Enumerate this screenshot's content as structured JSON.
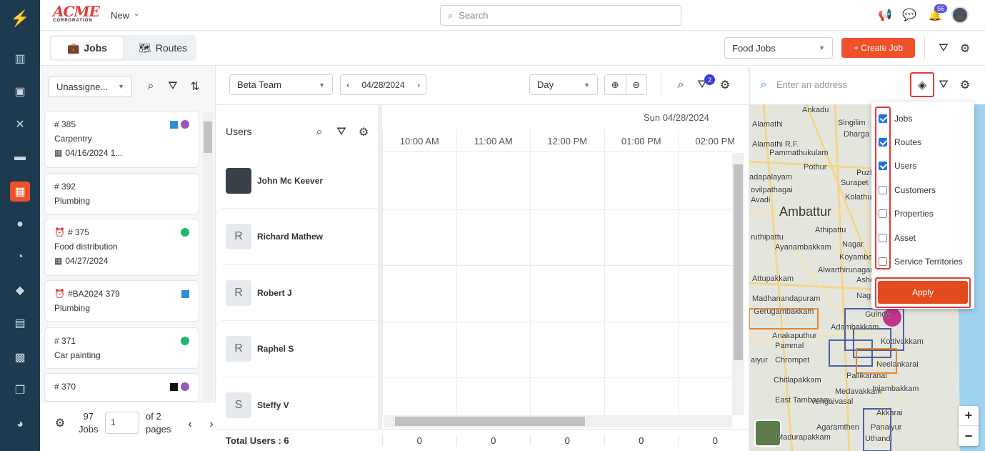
{
  "app": {
    "brand": "ACME",
    "brand_sub": "CORPORATION",
    "new_label": "New",
    "search_placeholder": "Search",
    "notif_count": "56"
  },
  "tabs": {
    "jobs": "Jobs",
    "routes": "Routes"
  },
  "header_right": {
    "job_filter": "Food Jobs",
    "create_job": "+ Create Job"
  },
  "jobs_panel": {
    "status_filter": "Unassigne...",
    "cards": [
      {
        "id": "# 385",
        "type": "Carpentry",
        "date": "04/16/2024 1...",
        "markers": [
          "#2b8fd6",
          "#9b59b6"
        ]
      },
      {
        "id": "# 392",
        "type": "Plumbing",
        "date": "",
        "markers": []
      },
      {
        "id": "# 375",
        "type": "Food distribution",
        "date": "04/27/2024",
        "markers": [
          "#22b573"
        ],
        "alarm": true
      },
      {
        "id": "#BA2024 379",
        "type": "Plumbing",
        "date": "",
        "markers": [
          "#2b8fd6"
        ],
        "alarm": true
      },
      {
        "id": "# 371",
        "type": "Car painting",
        "date": "",
        "markers": [
          "#22b573"
        ]
      },
      {
        "id": "# 370",
        "type": "",
        "date": "",
        "markers": [
          "#111111",
          "#9b59b6"
        ]
      }
    ],
    "footer": {
      "count": "97",
      "count_label": "Jobs",
      "page": "1",
      "of_pages": "of 2",
      "pages_label": "pages"
    }
  },
  "scheduler": {
    "team": "Beta Team",
    "date": "04/28/2024",
    "view": "Day",
    "filter_badge": "2",
    "date_header": "Sun 04/28/2024",
    "users_title": "Users",
    "times": [
      "10:00 AM",
      "11:00 AM",
      "12:00 PM",
      "01:00 PM",
      "02:00 PM"
    ],
    "users": [
      {
        "name": "John Mc Keever",
        "initial": "",
        "photo": true
      },
      {
        "name": "Richard Mathew",
        "initial": "R"
      },
      {
        "name": "Robert J",
        "initial": "R"
      },
      {
        "name": "Raphel S",
        "initial": "R"
      },
      {
        "name": "Steffy V",
        "initial": "S"
      }
    ],
    "total_label": "Total Users : 6",
    "totals": [
      "0",
      "0",
      "0",
      "0",
      "0"
    ]
  },
  "map": {
    "address_placeholder": "Enter an address",
    "layers": [
      {
        "label": "Jobs",
        "checked": true
      },
      {
        "label": "Routes",
        "checked": true
      },
      {
        "label": "Users",
        "checked": true
      },
      {
        "label": "Customers",
        "checked": false
      },
      {
        "label": "Properties",
        "checked": false
      },
      {
        "label": "Asset",
        "checked": false
      },
      {
        "label": "Service Territories",
        "checked": false
      }
    ],
    "apply_label": "Apply",
    "places": [
      "Ankadu",
      "Alamathi",
      "Singilim",
      "Dharga",
      "Alamathi R.F.",
      "Pammathukulam",
      "Pothur",
      "Puzhal",
      "adapalayam",
      "Surapet",
      "ovilpathagai",
      "Kolathur",
      "Avadi",
      "Ambattur",
      "Athipattu",
      "ruthipattu",
      "Ayanambakkam",
      "Nagar",
      "Koyambedu",
      "Attupakkam",
      "Alwarthirunagar",
      "Ashok",
      "Madhanandapuram",
      "Nagar",
      "Gerugambakkam",
      "Guindy",
      "Adambakkam",
      "Anakaputhur",
      "Pammal",
      "Kottivakkam",
      "aiyur",
      "Chrompet",
      "Neelankarai",
      "Pallikaranai",
      "Chitlapakkam",
      "Injambakkam",
      "Medavakkam",
      "East Tambaram",
      "Vengaivasal",
      "Akkarai",
      "Agaramthen",
      "Panaiyur",
      "Madurapakkam",
      "Uthandi"
    ],
    "zoom_in": "+",
    "zoom_out": "−"
  }
}
